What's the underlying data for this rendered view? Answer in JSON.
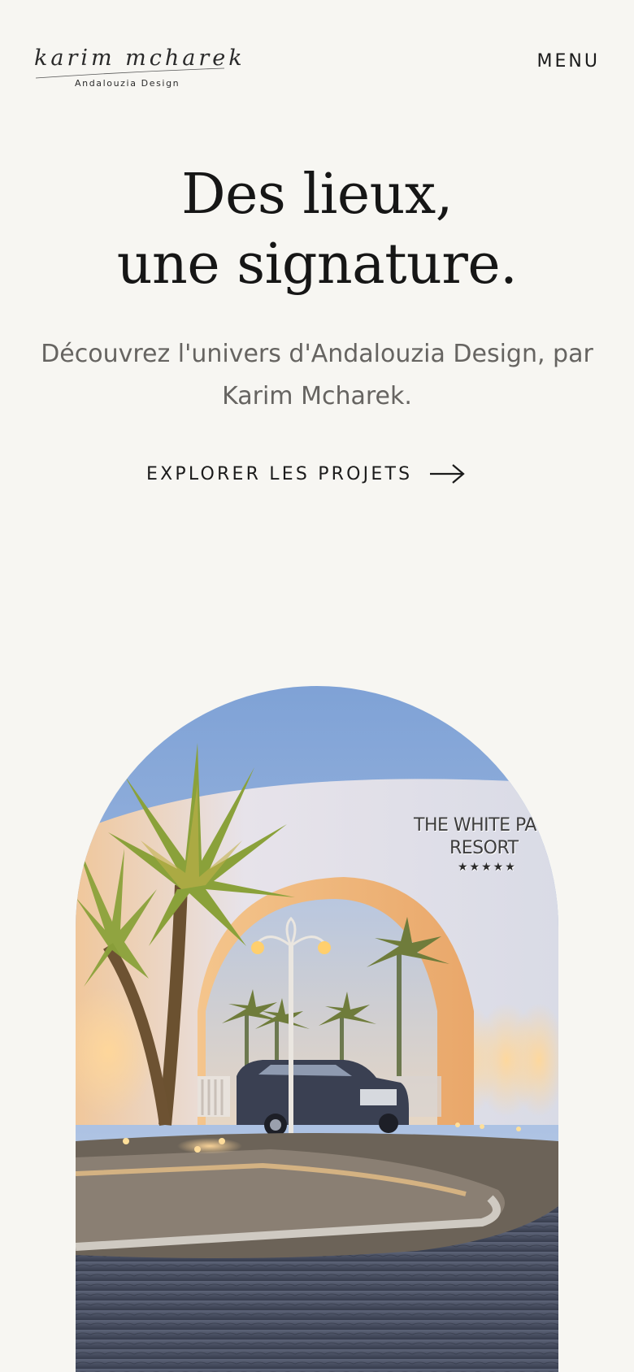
{
  "header": {
    "logo_script": "karim mcharek",
    "logo_subtitle": "Andalouzia Design",
    "menu_label": "MENU"
  },
  "hero": {
    "title_line1": "Des lieux,",
    "title_line2": "une signature.",
    "subtitle": "Découvrez l'univers d'Andalouzia Design, par Karim Mcharek.",
    "cta_label": "EXPLORER LES PROJETS",
    "cta_icon": "arrow-right-icon"
  },
  "featured_image": {
    "sign_line1": "THE WHITE PA",
    "sign_line2": "RESORT",
    "sign_stars": "★★★★★"
  },
  "colors": {
    "background": "#f7f6f2",
    "text": "#1b1b1b",
    "subtitle_text": "#666461"
  }
}
